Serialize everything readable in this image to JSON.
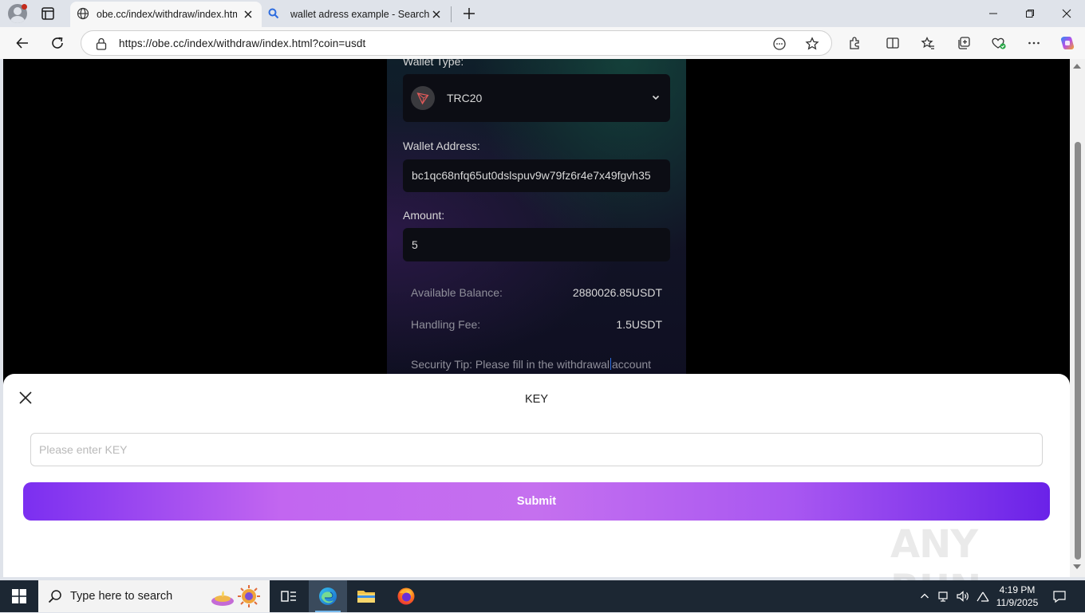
{
  "browser": {
    "tabs": [
      {
        "title": "obe.cc/index/withdraw/index.htm",
        "active": true
      },
      {
        "title": "wallet adress example - Search",
        "active": false
      }
    ],
    "url": "https://obe.cc/index/withdraw/index.html?coin=usdt"
  },
  "page": {
    "wallet_type_label": "Wallet Type:",
    "wallet_type_value": "TRC20",
    "wallet_address_label": "Wallet Address:",
    "wallet_address_value": "bc1qc68nfq65ut0dslspuv9w79fz6r4e7x49fgvh35",
    "amount_label": "Amount:",
    "amount_value": "5",
    "available_balance_label": "Available Balance:",
    "available_balance_value": "2880026.85USDT",
    "handling_fee_label": "Handling Fee:",
    "handling_fee_value": "1.5USDT",
    "security_tip_part1": "Security Tip: Please fill in the withdrawal",
    "security_tip_part2": "account"
  },
  "modal": {
    "title": "KEY",
    "input_placeholder": "Please enter KEY",
    "submit_label": "Submit",
    "watermark": "ANY RUN"
  },
  "taskbar": {
    "search_placeholder": "Type here to search",
    "time": "4:19 PM",
    "date": "11/9/2025"
  },
  "colors": {
    "submit_gradient_start": "#7b2ff0",
    "submit_gradient_mid": "#c570ef",
    "submit_gradient_end": "#6a22e8",
    "taskbar_bg": "#1c2733",
    "page_bg": "#000000"
  },
  "icons": [
    "profile-icon",
    "tab-actions-icon",
    "globe-icon",
    "search-icon",
    "close-icon",
    "plus-icon",
    "minimize-icon",
    "restore-icon",
    "back-arrow-icon",
    "refresh-icon",
    "lock-icon",
    "read-aloud-icon",
    "star-icon",
    "extensions-icon",
    "split-screen-icon",
    "favorites-icon",
    "collections-icon",
    "performance-icon",
    "more-icon",
    "copilot-icon",
    "tron-icon",
    "chevron-down-icon",
    "windows-logo-icon",
    "task-view-icon",
    "edge-icon",
    "file-explorer-icon",
    "firefox-icon"
  ]
}
